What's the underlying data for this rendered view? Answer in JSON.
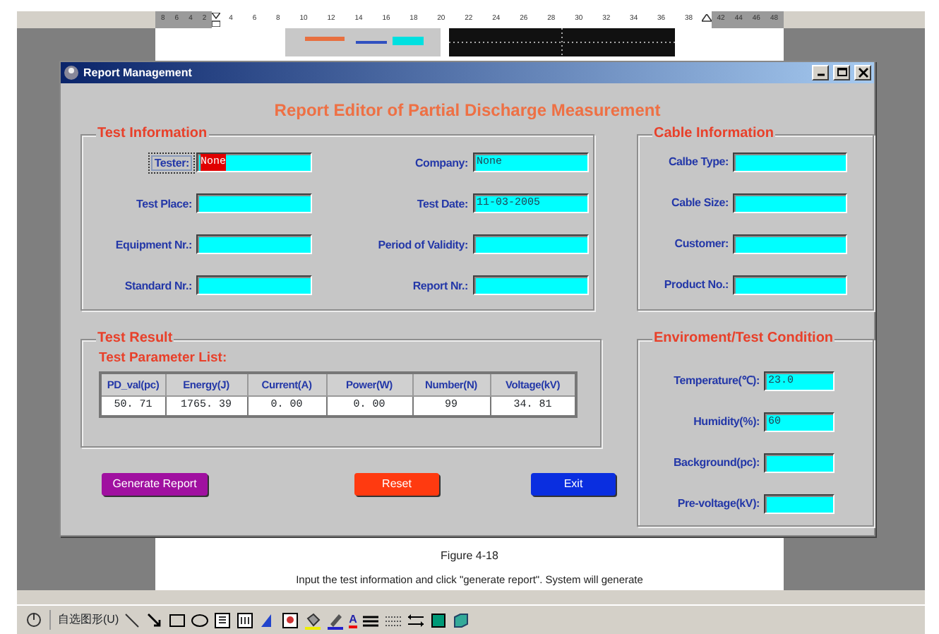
{
  "ruler": {
    "left_numbers": [
      "8",
      "6",
      "4",
      "2"
    ],
    "numbers": [
      "4",
      "6",
      "8",
      "10",
      "12",
      "14",
      "16",
      "18",
      "20",
      "22",
      "24",
      "26",
      "28",
      "30",
      "32",
      "34",
      "36",
      "38"
    ],
    "right_numbers": [
      "42",
      "44",
      "46",
      "48"
    ]
  },
  "window": {
    "title": "Report Management"
  },
  "heading": "Report Editor of Partial Discharge Measurement",
  "test_information": {
    "title": "Test Information",
    "fields": [
      {
        "label": "Tester:",
        "value": "None",
        "focused": true
      },
      {
        "label": "Company:",
        "value": "None",
        "focused": false
      },
      {
        "label": "Test Place:",
        "focused": false
      },
      {
        "label": "Test Date:",
        "value": "11-03-2005",
        "focused": false
      },
      {
        "label": "Equipment Nr.:",
        "focused": false
      },
      {
        "label": "Period of Validity:",
        "focused": false
      },
      {
        "label": "Standard Nr.:",
        "focused": false
      },
      {
        "label": "Report Nr.:",
        "focused": false
      }
    ]
  },
  "cable_information": {
    "title": "Cable Information",
    "fields": [
      {
        "label": "Calbe Type:"
      },
      {
        "label": "Cable Size:"
      },
      {
        "label": "Customer:"
      },
      {
        "label": "Product No.:"
      }
    ]
  },
  "test_result": {
    "title": "Test Result",
    "list_title": "Test Parameter List:",
    "table": {
      "columns": [
        "PD_val(pc)",
        "Energy(J)",
        "Current(A)",
        "Power(W)",
        "Number(N)",
        "Voltage(kV)"
      ],
      "rows": [
        [
          "50. 71",
          "1765. 39",
          "0. 00",
          "0. 00",
          "99",
          "34. 81"
        ]
      ]
    }
  },
  "environment": {
    "title": "Enviroment/Test Condition",
    "fields": [
      {
        "label": "Temperature(℃):",
        "value": "23.0"
      },
      {
        "label": "Humidity(%):",
        "value": "60"
      },
      {
        "label": "Background(pc):"
      },
      {
        "label": "Pre-voltage(kV):"
      }
    ]
  },
  "buttons": [
    {
      "label": "Generate Report",
      "color": "#a010a0"
    },
    {
      "label": "Reset",
      "color": "#ff3a10"
    },
    {
      "label": "Exit",
      "color": "#0a2ee0"
    }
  ],
  "document": {
    "caption": "Figure 4-18",
    "text": "Input the test information and click \"generate report\". System will generate"
  },
  "drawing_toolbar": {
    "menu": "自选图形(U)",
    "font_color_glyph": "A"
  }
}
